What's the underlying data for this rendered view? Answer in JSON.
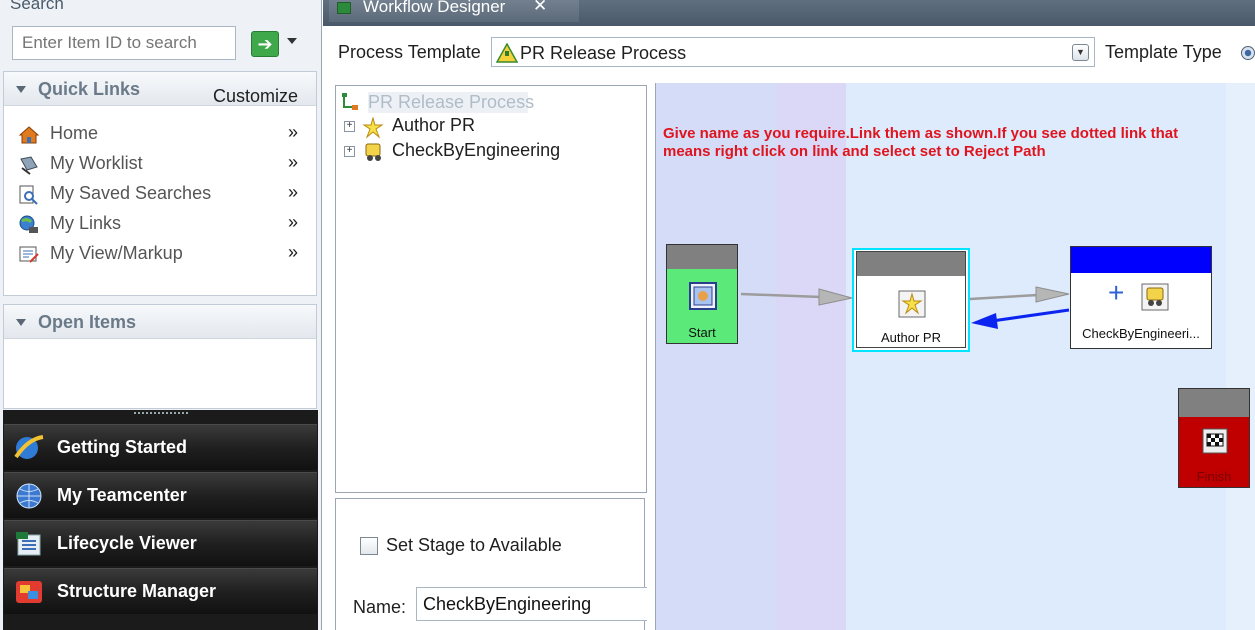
{
  "left_nav": {
    "search": {
      "header": "Search",
      "placeholder": "Enter Item ID to search"
    },
    "quick_links": {
      "title": "Quick Links",
      "customize": "Customize",
      "items": [
        {
          "label": "Home",
          "icon": "home-icon",
          "chevron": "»"
        },
        {
          "label": "My Worklist",
          "icon": "worklist-icon",
          "chevron": "»"
        },
        {
          "label": "My Saved Searches",
          "icon": "saved-searches-icon",
          "chevron": "»"
        },
        {
          "label": "My Links",
          "icon": "links-icon",
          "chevron": "»"
        },
        {
          "label": "My View/Markup",
          "icon": "markup-icon",
          "chevron": "»"
        }
      ]
    },
    "open_items": {
      "title": "Open Items"
    },
    "apps": [
      {
        "label": "Getting Started",
        "icon": "getting-started-icon"
      },
      {
        "label": "My Teamcenter",
        "icon": "my-teamcenter-icon"
      },
      {
        "label": "Lifecycle Viewer",
        "icon": "lifecycle-viewer-icon"
      },
      {
        "label": "Structure Manager",
        "icon": "structure-manager-icon"
      }
    ]
  },
  "workflow_designer": {
    "tab_title": "Workflow Designer",
    "close_glyph": "✕",
    "process_template_label": "Process Template",
    "process_template_value": "PR Release Process",
    "template_type_label": "Template Type",
    "tree": {
      "root": "PR Release Process",
      "children": [
        {
          "label": "Author PR",
          "icon": "do-task-icon",
          "expander": "+"
        },
        {
          "label": "CheckByEngineering",
          "icon": "review-task-icon",
          "expander": "+"
        }
      ]
    },
    "properties": {
      "stage_checkbox_label": "Set Stage to Available",
      "stage_checked": false,
      "name_label": "Name:",
      "name_value": "CheckByEngineering"
    },
    "canvas": {
      "instruction_line1": "Give name as you require.Link them as shown.If you see dotted link that",
      "instruction_line2": "means right click on link and select set to Reject Path",
      "nodes": [
        {
          "label": "Start",
          "header_color": "#808080",
          "body_color": "#5bea7a"
        },
        {
          "label": "Author PR",
          "header_color": "#808080",
          "body_color": "#ffffff",
          "selected": true
        },
        {
          "label": "CheckByEngineeri...",
          "header_color": "#0000ff",
          "body_color": "#ffffff",
          "expand_glyph": "+"
        },
        {
          "label": "Finish",
          "header_color": "#808080",
          "body_color": "#c00000"
        }
      ],
      "links": [
        {
          "from": "Start",
          "to": "Author PR",
          "type": "complete",
          "color": "#9c9c9c"
        },
        {
          "from": "Author PR",
          "to": "CheckByEngineeri...",
          "type": "complete",
          "color": "#9c9c9c"
        },
        {
          "from": "CheckByEngineeri...",
          "to": "Author PR",
          "type": "reject",
          "color": "#0b24f0"
        }
      ]
    }
  },
  "colors": {
    "instruction_text": "#e0141e",
    "selection_border": "#00e5ff",
    "canvas_band_light": "#e6effd",
    "canvas_band_purple": "#d6d7f6"
  }
}
